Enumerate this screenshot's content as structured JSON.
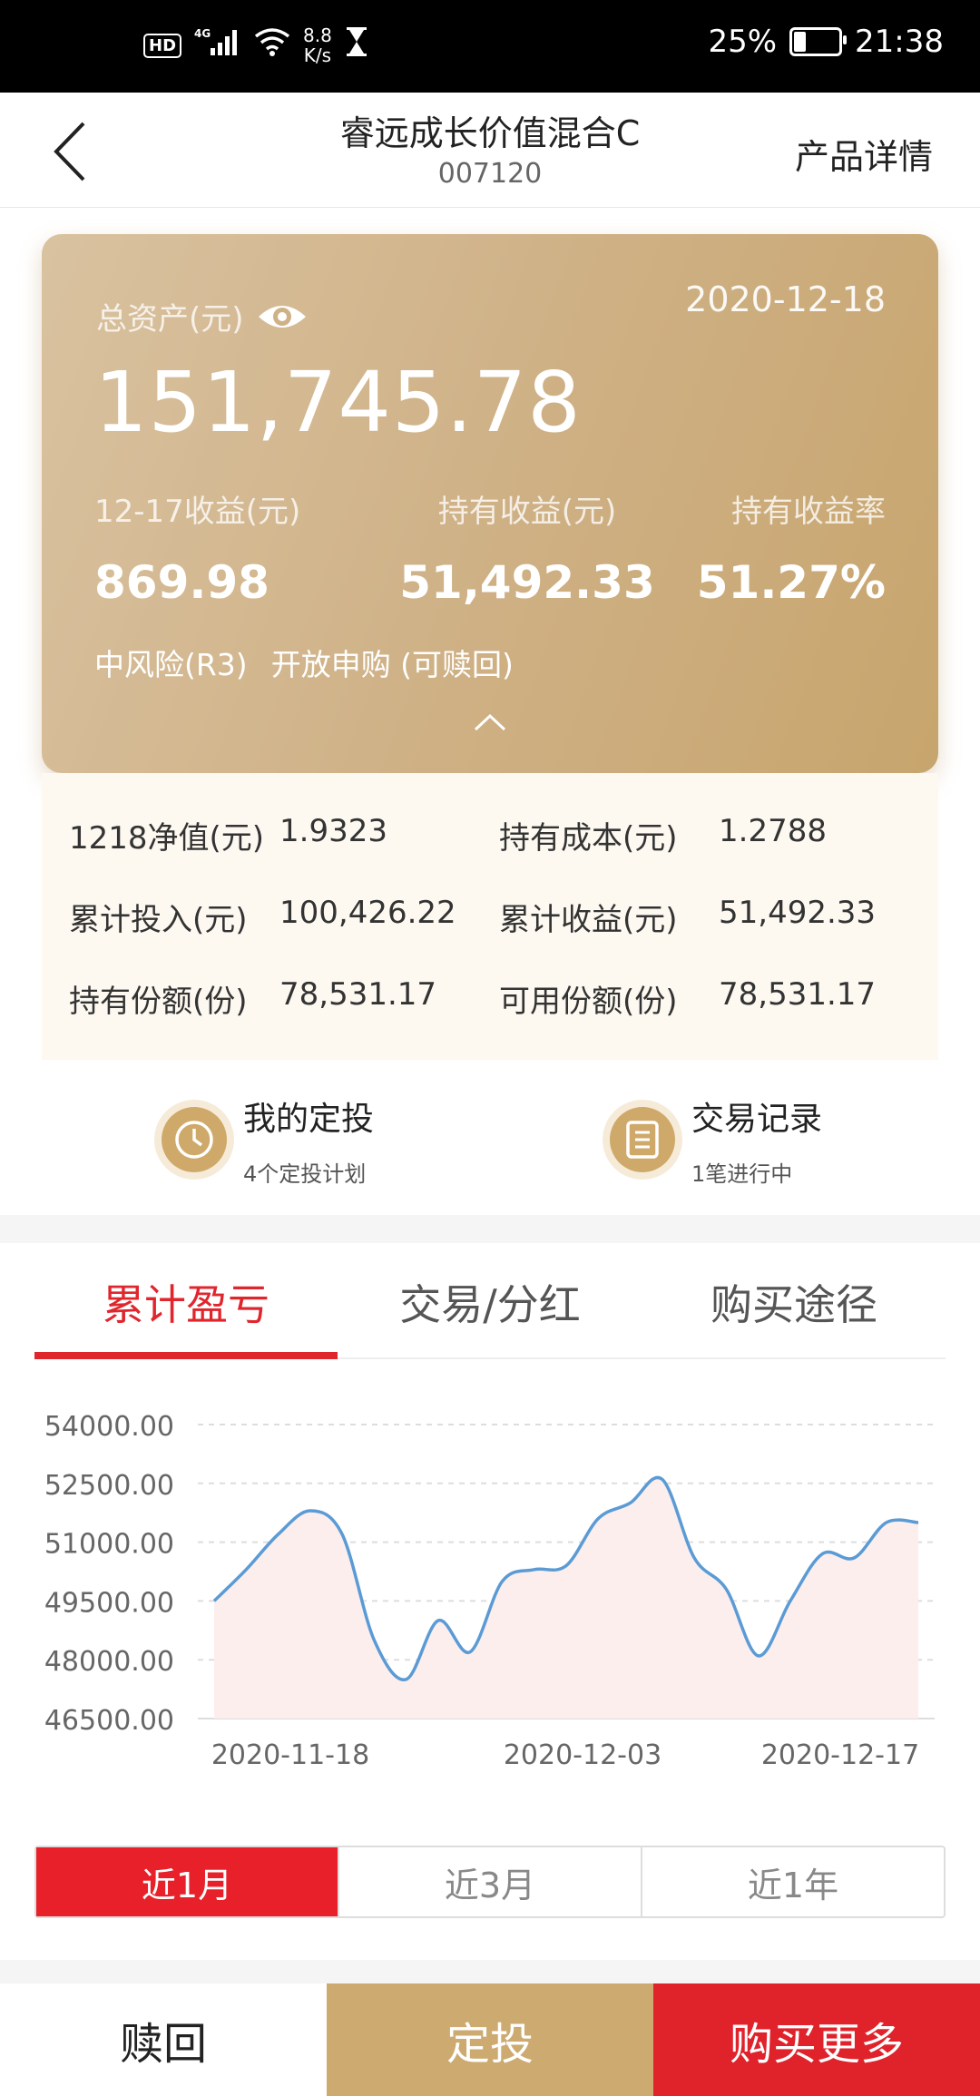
{
  "status_bar": {
    "speed_value": "8.8",
    "speed_unit": "K/s",
    "battery": "25%",
    "battery_level": 0.25,
    "time": "21:38"
  },
  "nav": {
    "title": "睿远成长价值混合C",
    "code": "007120",
    "right_label": "产品详情"
  },
  "card": {
    "asset_label": "总资产(元)",
    "date": "2020-12-18",
    "total_assets": "151,745.78",
    "metrics": [
      {
        "label": "12-17收益(元)",
        "value": "869.98"
      },
      {
        "label": "持有收益(元)",
        "value": "51,492.33"
      },
      {
        "label": "持有收益率",
        "value": "51.27%"
      }
    ],
    "risk": "中风险(R3)",
    "status": "开放申购 (可赎回)"
  },
  "details": [
    {
      "l1": "1218净值(元)",
      "v1": "1.9323",
      "l2": "持有成本(元)",
      "v2": "1.2788"
    },
    {
      "l1": "累计投入(元)",
      "v1": "100,426.22",
      "l2": "累计收益(元)",
      "v2": "51,492.33"
    },
    {
      "l1": "持有份额(份)",
      "v1": "78,531.17",
      "l2": "可用份额(份)",
      "v2": "78,531.17"
    }
  ],
  "shortcuts": [
    {
      "title": "我的定投",
      "sub": "4个定投计划",
      "icon": "clock-icon"
    },
    {
      "title": "交易记录",
      "sub": "1笔进行中",
      "icon": "list-icon"
    }
  ],
  "tabs": [
    "累计盈亏",
    "交易/分红",
    "购买途径"
  ],
  "chart_data": {
    "type": "area",
    "yticks": [
      "54000.00",
      "52500.00",
      "51000.00",
      "49500.00",
      "48000.00",
      "46500.00"
    ],
    "ylim": [
      46500,
      54000
    ],
    "xticks": [
      "2020-11-18",
      "2020-12-03",
      "2020-12-17"
    ],
    "x": [
      "11-18",
      "11-19",
      "11-20",
      "11-23",
      "11-24",
      "11-25",
      "11-26",
      "11-27",
      "11-30",
      "12-01",
      "12-02",
      "12-03",
      "12-04",
      "12-07",
      "12-08",
      "12-09",
      "12-10",
      "12-11",
      "12-14",
      "12-15",
      "12-16",
      "12-17",
      "12-18"
    ],
    "series": [
      {
        "values": [
          49500,
          50300,
          51200,
          51800,
          51200,
          48500,
          47500,
          49000,
          48200,
          50000,
          50300,
          50400,
          51600,
          52000,
          52600,
          50600,
          49800,
          48100,
          49500,
          50700,
          50600,
          51500,
          51500
        ]
      }
    ],
    "line_color": "#5b9bd5",
    "fill_color": "#fdeeee"
  },
  "ranges": [
    "近1月",
    "近3月",
    "近1年"
  ],
  "bottom_actions": [
    "赎回",
    "定投",
    "购买更多"
  ]
}
